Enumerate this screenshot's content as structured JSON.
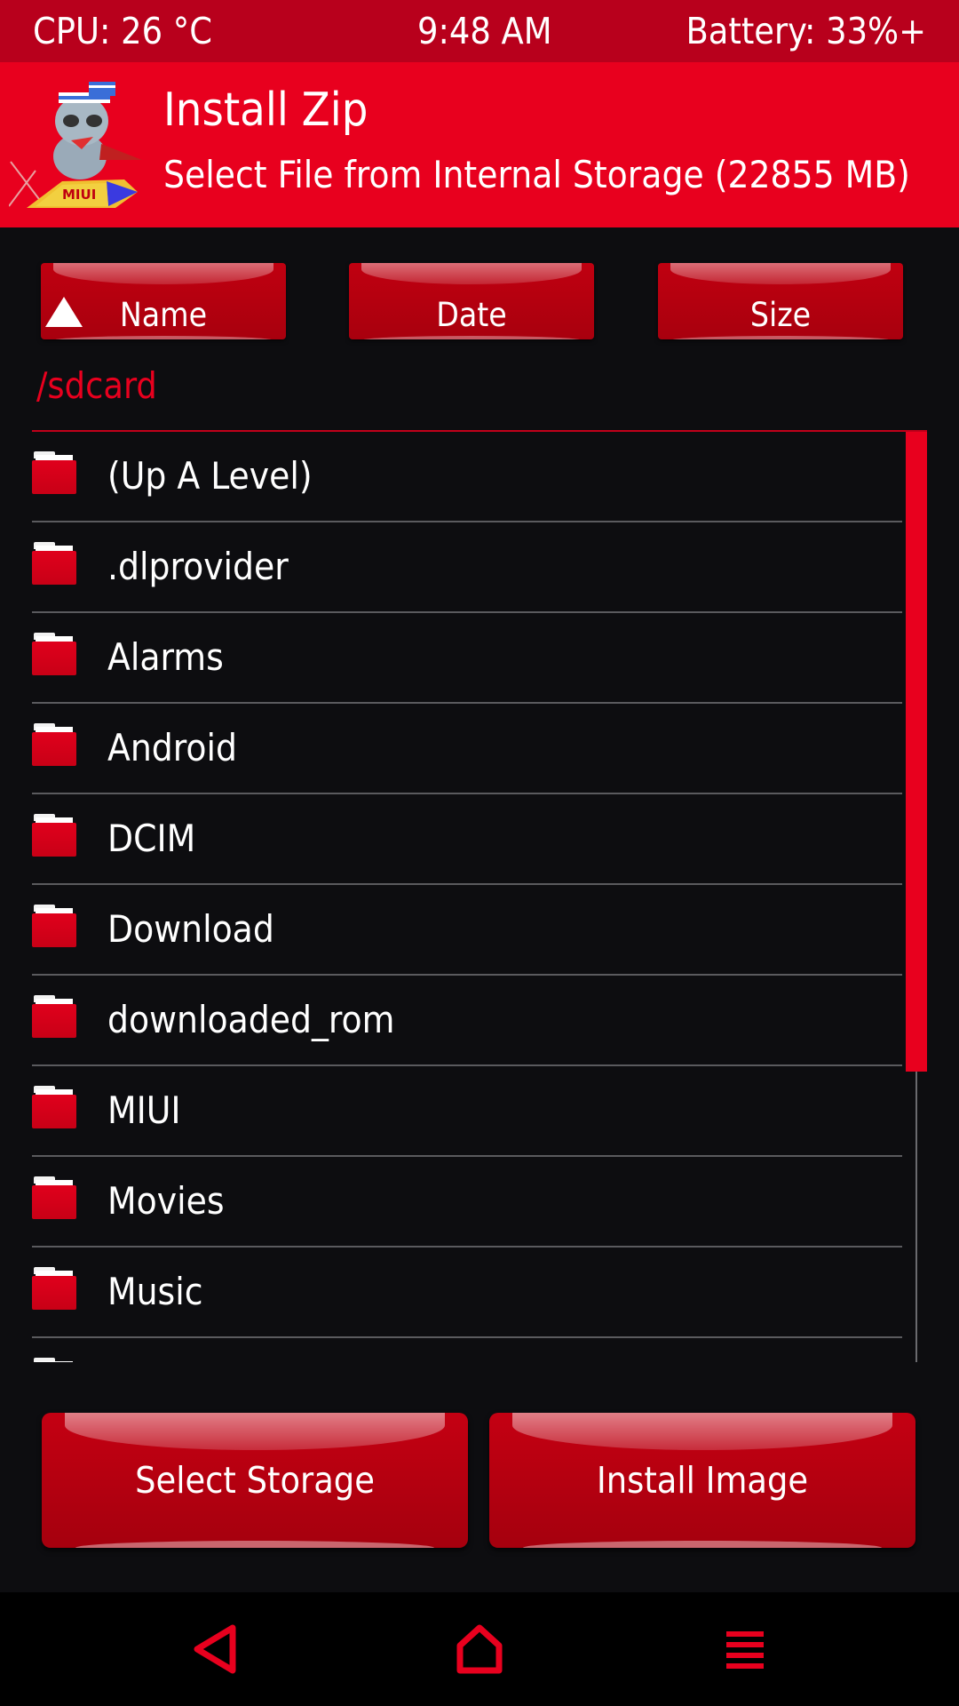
{
  "status_bar": {
    "cpu": "CPU: 26 °C",
    "time": "9:48 AM",
    "battery": "Battery: 33%+"
  },
  "header": {
    "title": "Install Zip",
    "subtitle": "Select File from Internal Storage (22855 MB)",
    "logo_icon": "miui-rocket-mascot-icon",
    "logo_text": "MIUI"
  },
  "sort_buttons": {
    "name": "Name",
    "date": "Date",
    "size": "Size",
    "active_sort_icon": "triangle-up-icon"
  },
  "current_path": "/sdcard",
  "files": [
    {
      "name": "(Up A Level)",
      "icon": "folder-icon"
    },
    {
      "name": ".dlprovider",
      "icon": "folder-icon"
    },
    {
      "name": "Alarms",
      "icon": "folder-icon"
    },
    {
      "name": "Android",
      "icon": "folder-icon"
    },
    {
      "name": "DCIM",
      "icon": "folder-icon"
    },
    {
      "name": "Download",
      "icon": "folder-icon"
    },
    {
      "name": "downloaded_rom",
      "icon": "folder-icon"
    },
    {
      "name": "MIUI",
      "icon": "folder-icon"
    },
    {
      "name": "Movies",
      "icon": "folder-icon"
    },
    {
      "name": "Music",
      "icon": "folder-icon"
    },
    {
      "name": "",
      "icon": "folder-icon"
    }
  ],
  "actions": {
    "select_storage": "Select Storage",
    "install_image": "Install Image"
  },
  "nav_bar": {
    "back_icon": "back-triangle-icon",
    "home_icon": "home-icon",
    "menu_icon": "menu-icon"
  },
  "colors": {
    "accent": "#e8001e",
    "status_bar": "#b8001c",
    "background": "#0d0d10",
    "divider": "#5a5a5e"
  }
}
